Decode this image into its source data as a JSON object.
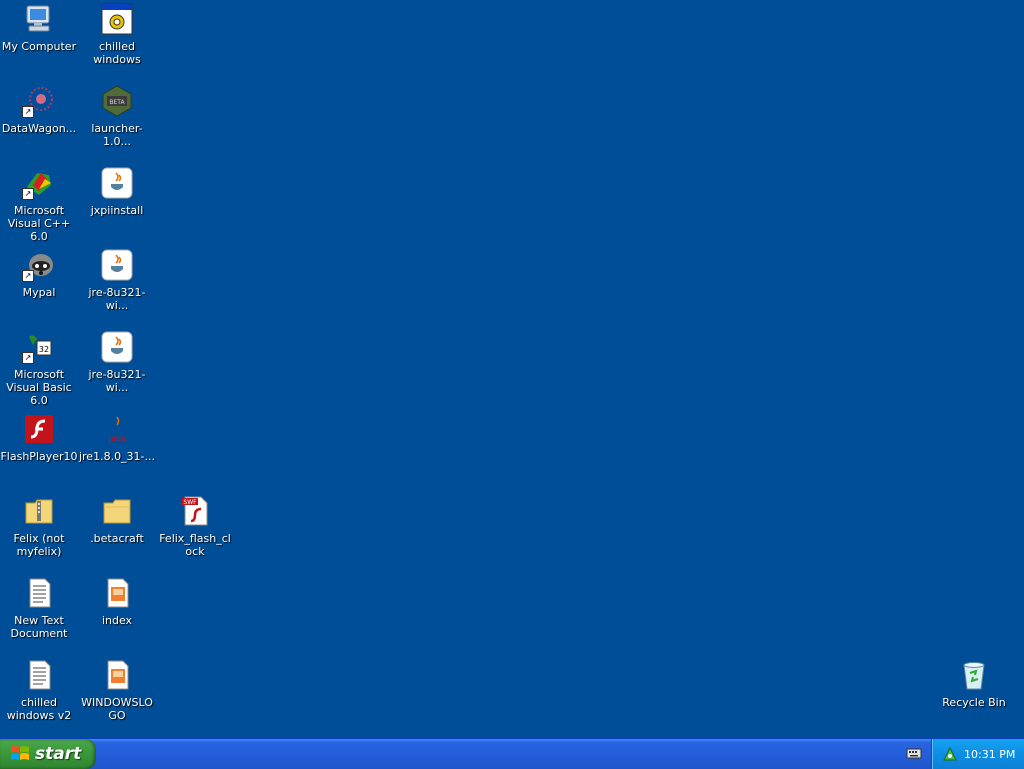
{
  "desktop": {
    "background_color": "#004e98",
    "icons": [
      {
        "label": "My Computer",
        "icon": "my-computer-icon"
      },
      {
        "label": "chilled windows",
        "icon": "program-window-icon"
      },
      {
        "label": "DataWagon...",
        "icon": "datawagon-icon"
      },
      {
        "label": "launcher-1.0...",
        "icon": "betacraft-launcher-icon"
      },
      {
        "label": "Microsoft Visual C++ 6.0",
        "icon": "visual-cpp-icon"
      },
      {
        "label": "jxpiinstall",
        "icon": "java-icon"
      },
      {
        "label": "Mypal",
        "icon": "mypal-icon"
      },
      {
        "label": "jre-8u321-wi...",
        "icon": "java-icon"
      },
      {
        "label": "Microsoft Visual Basic 6.0",
        "icon": "visual-basic-icon"
      },
      {
        "label": "jre-8u321-wi...",
        "icon": "java-icon"
      },
      {
        "label": "FlashPlayer10",
        "icon": "flash-player-icon"
      },
      {
        "label": "jre1.8.0_31-...",
        "icon": "java-logo-icon"
      },
      {
        "label": "Felix (not myfelix)",
        "icon": "zip-folder-icon"
      },
      {
        "label": ".betacraft",
        "icon": "folder-icon"
      },
      {
        "label": "Felix_flash_clock",
        "icon": "swf-file-icon"
      },
      {
        "label": "New Text Document",
        "icon": "text-document-icon"
      },
      {
        "label": "index",
        "icon": "html-document-icon"
      },
      {
        "label": "chilled windows v2",
        "icon": "text-document-icon"
      },
      {
        "label": "WINDOWSLOGO",
        "icon": "html-document-icon"
      },
      {
        "label": "Recycle Bin",
        "icon": "recycle-bin-icon"
      }
    ]
  },
  "taskbar": {
    "start_label": "start",
    "clock": "10:31 PM",
    "tray_icons": [
      "network-icon"
    ],
    "quick_icons": [
      "keyboard-icon"
    ]
  }
}
